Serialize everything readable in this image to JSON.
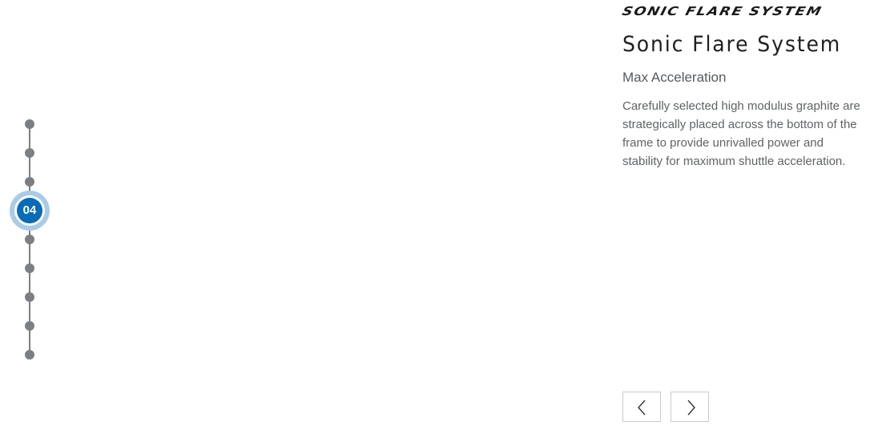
{
  "brand": {
    "logo_text": "SONIC FLARE SYSTEM"
  },
  "timeline": {
    "active_label": "04",
    "active_index": 3,
    "total_steps": 9,
    "colors": {
      "dot": "#7b7f82",
      "active_core": "#0a6bb8",
      "active_halo": "#a9cbe6"
    }
  },
  "feature": {
    "title": "Sonic Flare System",
    "subtitle": "Max Acceleration",
    "description": "Carefully selected high modulus graphite are strategically placed across the bottom of the frame to provide unrivalled power and stability for maximum shuttle acceleration."
  },
  "navigation": {
    "prev_icon": "chevron-left-icon",
    "next_icon": "chevron-right-icon"
  }
}
